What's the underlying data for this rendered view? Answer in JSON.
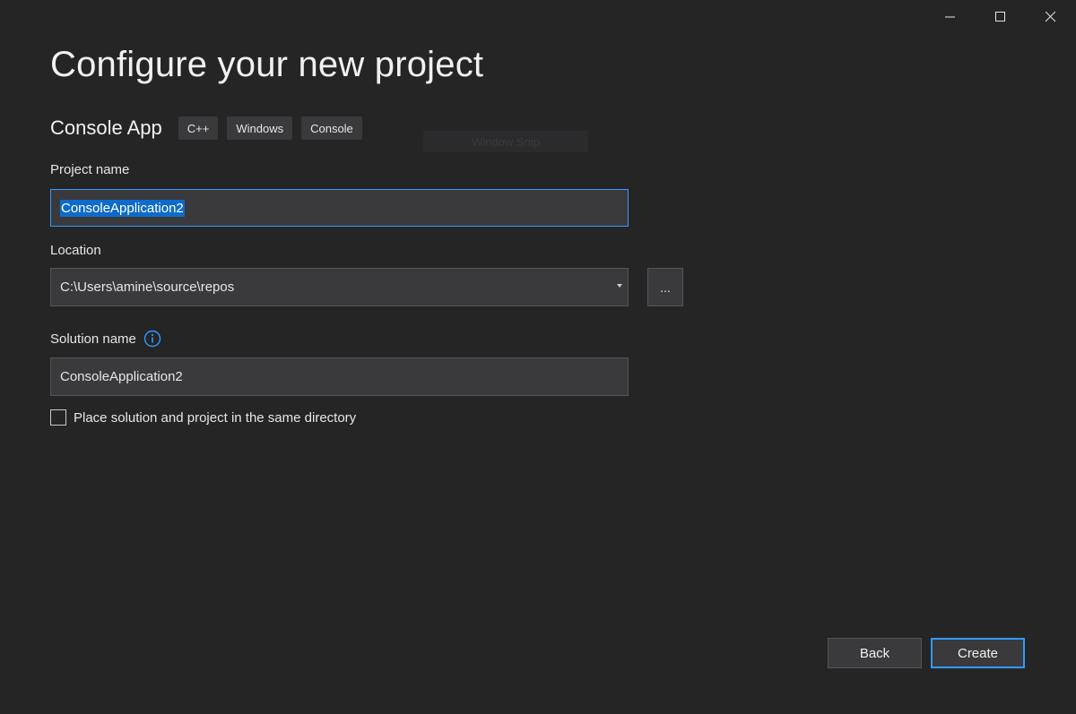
{
  "window": {
    "controls": {
      "minimize_icon": "minimize-icon",
      "maximize_icon": "maximize-icon",
      "close_icon": "close-icon"
    }
  },
  "header": {
    "title": "Configure your new project"
  },
  "template": {
    "name": "Console App",
    "tags": [
      "C++",
      "Windows",
      "Console"
    ]
  },
  "ghost_tooltip": "Window Snip",
  "form": {
    "project_name": {
      "label": "Project name",
      "value": "ConsoleApplication2",
      "selected": true
    },
    "location": {
      "label": "Location",
      "value": "C:\\Users\\amine\\source\\repos",
      "browse_label": "..."
    },
    "solution_name": {
      "label": "Solution name",
      "value": "ConsoleApplication2",
      "info_icon": "info-icon"
    },
    "same_directory": {
      "label": "Place solution and project in the same directory",
      "checked": false
    }
  },
  "footer": {
    "back_label": "Back",
    "create_label": "Create"
  },
  "colors": {
    "background": "#252526",
    "input_bg": "#3a3a3d",
    "accent": "#3399ff",
    "selection": "#0e6bc9"
  }
}
